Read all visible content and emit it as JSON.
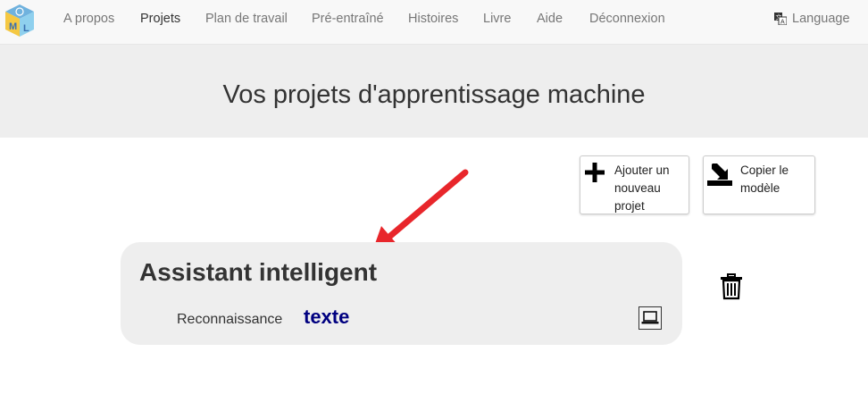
{
  "navbar": {
    "logo_icon": "ml-cube-logo",
    "items": [
      {
        "label": "A propos",
        "active": false
      },
      {
        "label": "Projets",
        "active": true
      },
      {
        "label": "Plan de travail",
        "active": false
      },
      {
        "label": "Pré-entraîné",
        "active": false
      },
      {
        "label": "Histoires",
        "active": false
      },
      {
        "label": "Livre",
        "active": false
      },
      {
        "label": "Aide",
        "active": false
      },
      {
        "label": "Déconnexion",
        "active": false
      }
    ],
    "language_label": "Language",
    "language_icon": "translate-icon"
  },
  "page": {
    "title": "Vos projets d'apprentissage machine"
  },
  "actions": {
    "add_project": {
      "label": "Ajouter un nouveau projet",
      "icon": "plus-icon"
    },
    "copy_model": {
      "label": "Copier le modèle",
      "icon": "import-icon"
    }
  },
  "projects": [
    {
      "name": "Assistant intelligent",
      "type_label": "Reconnaissance",
      "type_value": "texte",
      "storage_icon": "laptop-icon",
      "delete_icon": "trash-icon"
    }
  ],
  "colors": {
    "navbar_bg": "#f8f8f8",
    "jumbotron_bg": "#eeeeee",
    "card_bg": "#eeeeee",
    "type_value_color": "#000080",
    "annotation_arrow": "#e8262b"
  }
}
